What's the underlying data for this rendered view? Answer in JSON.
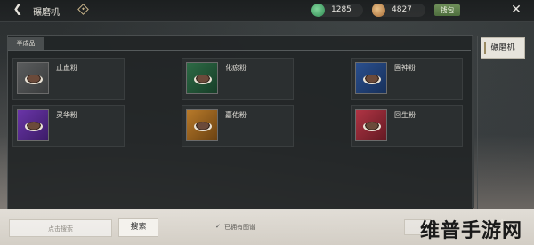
{
  "header": {
    "title": "碾磨机",
    "jade_amount": "1285",
    "coin_amount": "4827",
    "top_right_button": "钱包"
  },
  "panel": {
    "category_tab": "半成品",
    "items": [
      {
        "name": "止血粉",
        "color": "#5a5c5d"
      },
      {
        "name": "化瘀粉",
        "color": "#2d6a45"
      },
      {
        "name": "固神粉",
        "color": "#2a4f8e"
      },
      {
        "name": "灵华粉",
        "color": "#6a35a8"
      },
      {
        "name": "嘉佑粉",
        "color": "#b87a2a"
      },
      {
        "name": "回生粉",
        "color": "#b03444"
      }
    ]
  },
  "side": {
    "active_tab": "碾磨机"
  },
  "bottom": {
    "search_placeholder": "点击搜索",
    "search_button": "搜索",
    "filter_label": "已拥有图谱"
  },
  "watermark": "维普手游网"
}
